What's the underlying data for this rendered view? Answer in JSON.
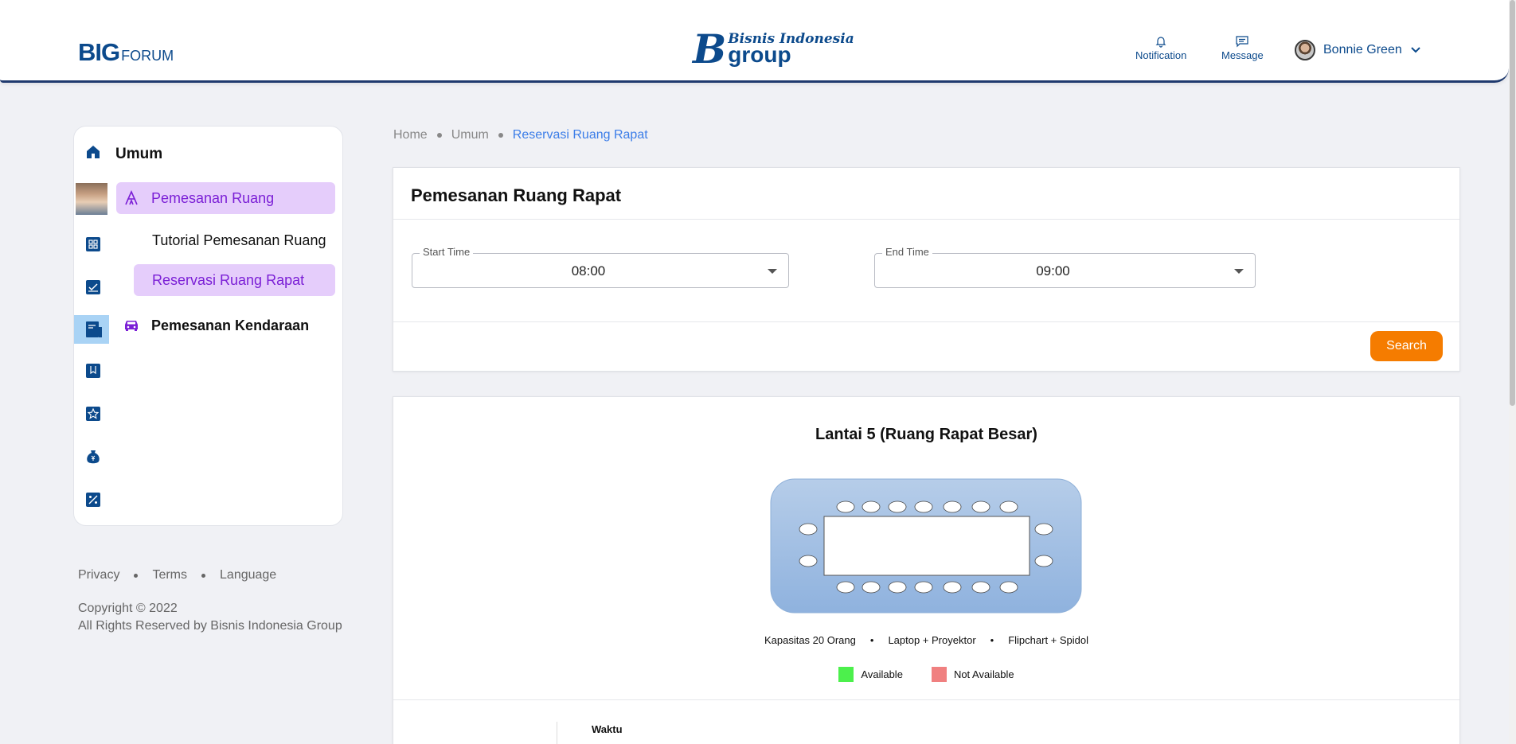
{
  "header": {
    "logo_big": "BIG",
    "logo_forum": "FORUM",
    "brand_line1": "Bisnis Indonesia",
    "brand_line2": "group",
    "notification_label": "Notification",
    "message_label": "Message",
    "user_name": "Bonnie Green",
    "icons": {
      "notification": "bell-icon",
      "message": "message-icon",
      "dropdown": "chevron-down-icon"
    }
  },
  "sidebar": {
    "title": "Umum",
    "items": [
      {
        "label": "Pemesanan Ruang",
        "icon": "people-icon",
        "active": true
      },
      {
        "label": "Tutorial Pemesanan Ruang",
        "active": false
      },
      {
        "label": "Reservasi Ruang Rapat",
        "active": true
      },
      {
        "label": "Pemesanan Kendaraan",
        "icon": "car-icon",
        "active": false
      }
    ],
    "rail_icons": [
      "home-icon",
      "user-photo",
      "grid-icon",
      "inbox-check-icon",
      "document-icon",
      "bookmark-icon",
      "star-icon",
      "money-bag-icon",
      "percent-icon"
    ],
    "accent": "#7b1fd6",
    "active_bg": "#e5cdfb"
  },
  "footer": {
    "links": [
      "Privacy",
      "Terms",
      "Language"
    ],
    "copyright": "Copyright © 2022",
    "rights": "All Rights Reserved by Bisnis Indonesia Group"
  },
  "breadcrumb": [
    "Home",
    "Umum",
    "Reservasi Ruang Rapat"
  ],
  "form": {
    "title": "Pemesanan Ruang Rapat",
    "start_label": "Start Time",
    "start_value": "08:00",
    "end_label": "End Time",
    "end_value": "09:00",
    "search_label": "Search",
    "search_color": "#f57c00"
  },
  "room": {
    "title": "Lantai 5 (Ruang Rapat Besar)",
    "features": [
      "Kapasitas 20 Orang",
      "Laptop + Proyektor",
      "Flipchart + Spidol"
    ],
    "legend": [
      {
        "label": "Available",
        "color": "#4cf04c"
      },
      {
        "label": "Not Available",
        "color": "#f08080"
      }
    ],
    "schedule_header": "Waktu"
  }
}
